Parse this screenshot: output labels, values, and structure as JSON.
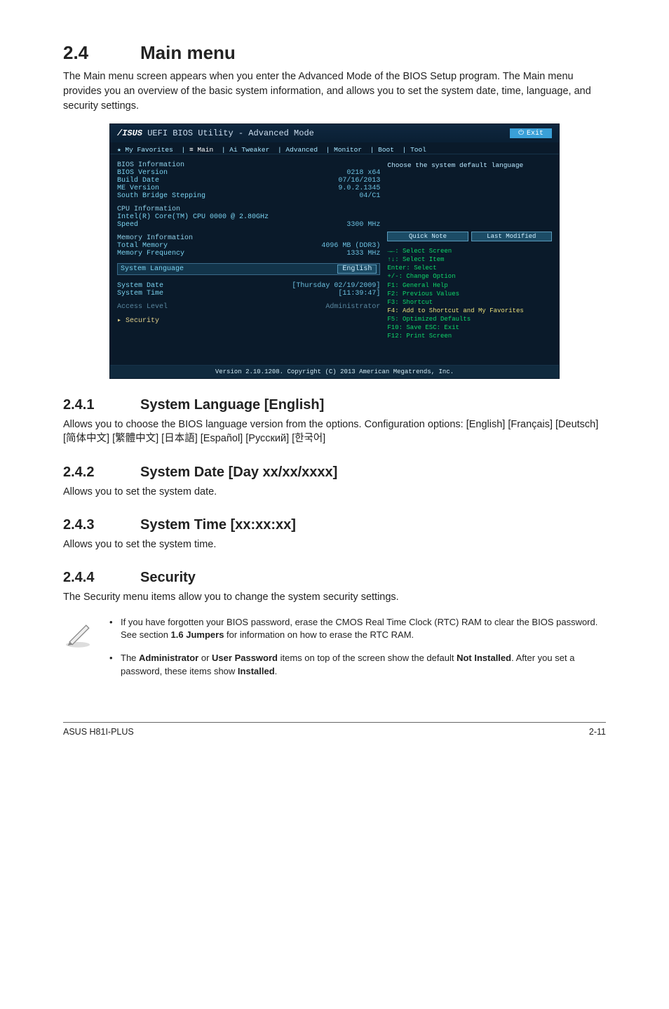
{
  "section24": {
    "num": "2.4",
    "title": "Main menu",
    "para": "The Main menu screen appears when you enter the Advanced Mode of the BIOS Setup program. The Main menu provides you an overview of the basic system information, and allows you to set the system date, time, language, and security settings."
  },
  "bios": {
    "title_logo": "/ISUS",
    "title_text": "UEFI BIOS Utility - Advanced Mode",
    "exit": "Exit",
    "tabs": {
      "fav": "★ My Favorites",
      "main": "≡ Main",
      "ai": "Ai Tweaker",
      "adv": "Advanced",
      "mon": "Monitor",
      "boot": "Boot",
      "tool": "Tool"
    },
    "right_hint": "Choose the system default language",
    "info": {
      "bios_info_hdr": "BIOS Information",
      "bios_version_l": "BIOS Version",
      "bios_version_v": "0218 x64",
      "build_l": "Build Date",
      "build_v": "07/16/2013",
      "me_l": "ME Version",
      "me_v": "9.0.2.1345",
      "sb_l": "South Bridge Stepping",
      "sb_v": "04/C1",
      "cpu_hdr": "CPU Information",
      "cpu_name": "Intel(R) Core(TM) CPU 0000 @ 2.80GHz",
      "speed_l": "Speed",
      "speed_v": "3300 MHz",
      "mem_hdr": "Memory Information",
      "total_l": "Total Memory",
      "total_v": "4096 MB (DDR3)",
      "freq_l": "Memory Frequency",
      "freq_v": "1333 MHz",
      "lang_l": "System Language",
      "lang_v": "English",
      "date_l": "System Date",
      "date_v": "[Thursday 02/19/2009]",
      "time_l": "System Time",
      "time_v": "[11:39:47]",
      "access_l": "Access Level",
      "access_v": "Administrator",
      "security": "Security"
    },
    "quicknote": "Quick Note",
    "lastmod": "Last Modified",
    "help": {
      "l1": "→←: Select Screen",
      "l2": "↑↓: Select Item",
      "l3": "Enter: Select",
      "l4": "+/-: Change Option",
      "l5": "F1: General Help",
      "l6": "F2: Previous Values",
      "l7": "F3: Shortcut",
      "l8": "F4: Add to Shortcut and My Favorites",
      "l9": "F5: Optimized Defaults",
      "l10": "F10: Save  ESC: Exit",
      "l11": "F12: Print Screen"
    },
    "footer": "Version 2.10.1208. Copyright (C) 2013 American Megatrends, Inc."
  },
  "s241": {
    "num": "2.4.1",
    "title": "System Language [English]",
    "desc": "Allows you to choose the BIOS language version from the options. Configuration options: [English] [Français] [Deutsch] [简体中文] [繁體中文] [日本語] [Español] [Русский] [한국어]"
  },
  "s242": {
    "num": "2.4.2",
    "title": "System Date [Day xx/xx/xxxx]",
    "desc": "Allows you to set the system date."
  },
  "s243": {
    "num": "2.4.3",
    "title": "System Time [xx:xx:xx]",
    "desc": "Allows you to set the system time."
  },
  "s244": {
    "num": "2.4.4",
    "title": "Security",
    "desc": "The Security menu items allow you to change the system security settings."
  },
  "note": {
    "b1a": "If you have forgotten your BIOS password, erase the CMOS Real Time Clock (RTC) RAM to clear the BIOS password. See section ",
    "b1b": "1.6 Jumpers",
    "b1c": " for information on how to erase the RTC RAM.",
    "b2a": "The ",
    "b2b": "Administrator",
    "b2c": " or ",
    "b2d": "User Password",
    "b2e": " items on top of the screen show the default ",
    "b2f": "Not Installed",
    "b2g": ". After you set a password, these items show ",
    "b2h": "Installed",
    "b2i": "."
  },
  "footer": {
    "left": "ASUS H81I-PLUS",
    "right": "2-11"
  }
}
